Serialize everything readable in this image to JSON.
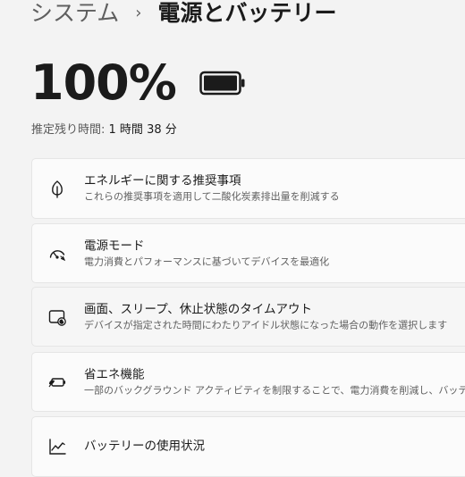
{
  "breadcrumb": {
    "parent": "システム",
    "separator": "›",
    "current": "電源とバッテリー"
  },
  "battery": {
    "percent_text": "100%",
    "level_fraction": 1.0,
    "icon": "battery-full-icon"
  },
  "remaining": {
    "label": "推定残り時間:",
    "value": "1 時間 38 分"
  },
  "cards": [
    {
      "icon": "leaf-icon",
      "title": "エネルギーに関する推奨事項",
      "subtitle": "これらの推奨事項を適用して二酸化炭素排出量を削減する"
    },
    {
      "icon": "speedometer-icon",
      "title": "電源モード",
      "subtitle": "電力消費とパフォーマンスに基づいてデバイスを最適化"
    },
    {
      "icon": "screen-sleep-icon",
      "title": "画面、スリープ、休止状態のタイムアウト",
      "subtitle": "デバイスが指定された時間にわたりアイドル状態になった場合の動作を選択します"
    },
    {
      "icon": "battery-saver-icon",
      "title": "省エネ機能",
      "subtitle": "一部のバックグラウンド アクティビティを制限することで、電力消費を削減し、バッテリーの寿命"
    },
    {
      "icon": "line-chart-icon",
      "title": "バッテリーの使用状況",
      "subtitle": ""
    }
  ]
}
